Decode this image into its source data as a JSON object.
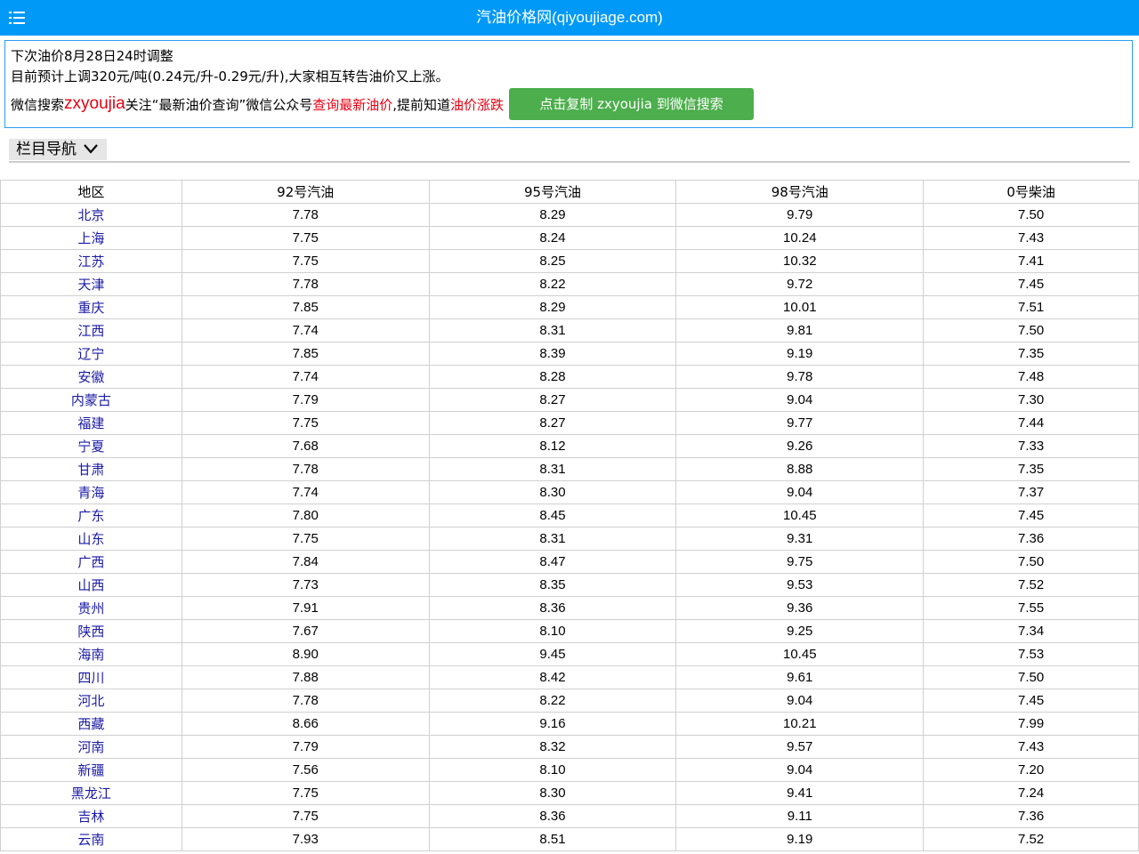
{
  "header": {
    "title": "汽油价格网(qiyoujiage.com)"
  },
  "notice": {
    "line1": "下次油价8月28日24时调整",
    "line2": "目前预计上调320元/吨(0.24元/升-0.29元/升),大家相互转告油价又上涨。",
    "wechat_prefix": "微信搜索 ",
    "wechat_id": "zxyoujia",
    "follow_text": " 关注“最新油价查询”微信公众号 ",
    "link_query": "查询最新油价",
    "middle_text": ",提前知道",
    "link_trend": "油价涨跌",
    "copy_button": "点击复制 zxyoujia 到微信搜索"
  },
  "nav": {
    "label": "栏目导航"
  },
  "table": {
    "headers": [
      "地区",
      "92号汽油",
      "95号汽油",
      "98号汽油",
      "0号柴油"
    ],
    "rows": [
      [
        "北京",
        "7.78",
        "8.29",
        "9.79",
        "7.50"
      ],
      [
        "上海",
        "7.75",
        "8.24",
        "10.24",
        "7.43"
      ],
      [
        "江苏",
        "7.75",
        "8.25",
        "10.32",
        "7.41"
      ],
      [
        "天津",
        "7.78",
        "8.22",
        "9.72",
        "7.45"
      ],
      [
        "重庆",
        "7.85",
        "8.29",
        "10.01",
        "7.51"
      ],
      [
        "江西",
        "7.74",
        "8.31",
        "9.81",
        "7.50"
      ],
      [
        "辽宁",
        "7.85",
        "8.39",
        "9.19",
        "7.35"
      ],
      [
        "安徽",
        "7.74",
        "8.28",
        "9.78",
        "7.48"
      ],
      [
        "内蒙古",
        "7.79",
        "8.27",
        "9.04",
        "7.30"
      ],
      [
        "福建",
        "7.75",
        "8.27",
        "9.77",
        "7.44"
      ],
      [
        "宁夏",
        "7.68",
        "8.12",
        "9.26",
        "7.33"
      ],
      [
        "甘肃",
        "7.78",
        "8.31",
        "8.88",
        "7.35"
      ],
      [
        "青海",
        "7.74",
        "8.30",
        "9.04",
        "7.37"
      ],
      [
        "广东",
        "7.80",
        "8.45",
        "10.45",
        "7.45"
      ],
      [
        "山东",
        "7.75",
        "8.31",
        "9.31",
        "7.36"
      ],
      [
        "广西",
        "7.84",
        "8.47",
        "9.75",
        "7.50"
      ],
      [
        "山西",
        "7.73",
        "8.35",
        "9.53",
        "7.52"
      ],
      [
        "贵州",
        "7.91",
        "8.36",
        "9.36",
        "7.55"
      ],
      [
        "陕西",
        "7.67",
        "8.10",
        "9.25",
        "7.34"
      ],
      [
        "海南",
        "8.90",
        "9.45",
        "10.45",
        "7.53"
      ],
      [
        "四川",
        "7.88",
        "8.42",
        "9.61",
        "7.50"
      ],
      [
        "河北",
        "7.78",
        "8.22",
        "9.04",
        "7.45"
      ],
      [
        "西藏",
        "8.66",
        "9.16",
        "10.21",
        "7.99"
      ],
      [
        "河南",
        "7.79",
        "8.32",
        "9.57",
        "7.43"
      ],
      [
        "新疆",
        "7.56",
        "8.10",
        "9.04",
        "7.20"
      ],
      [
        "黑龙江",
        "7.75",
        "8.30",
        "9.41",
        "7.24"
      ],
      [
        "吉林",
        "7.75",
        "8.36",
        "9.11",
        "7.36"
      ],
      [
        "云南",
        "7.93",
        "8.51",
        "9.19",
        "7.52"
      ]
    ]
  },
  "colors": {
    "header_bg": "#0099f7",
    "notice_border": "#2a9bf3",
    "accent_red": "#e60012",
    "button_green": "#4cae4c",
    "region_link": "#1a1aa6"
  },
  "icons": {
    "menu": "hamburger-menu-icon",
    "nav_toggle": "chevron-down-icon"
  }
}
